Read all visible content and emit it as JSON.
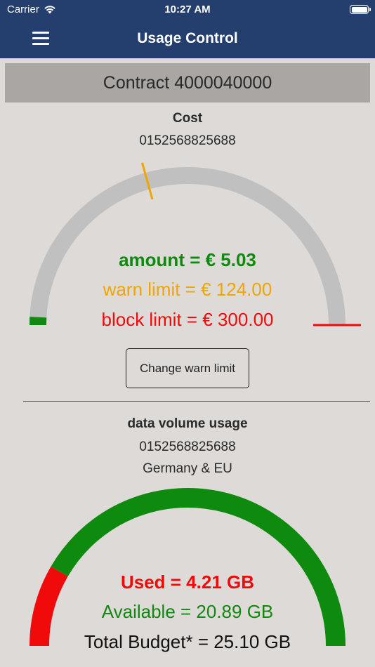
{
  "status": {
    "carrier": "Carrier",
    "time": "10:27 AM"
  },
  "nav": {
    "title": "Usage Control",
    "menu_icon": "hamburger-icon"
  },
  "contract": {
    "label": "Contract 4000040000"
  },
  "cost": {
    "title": "Cost",
    "number": "0152568825688",
    "amount_text": "amount = € 5.03",
    "warn_text": "warn limit = € 124.00",
    "block_text": "block limit = € 300.00",
    "amount": 5.03,
    "warn_limit": 124.0,
    "block_limit": 300.0,
    "change_button_label": "Change warn limit",
    "colors": {
      "track": "#c0c0c0",
      "amount": "#0e8a0e",
      "warn": "#f0a500",
      "block": "#f00a0a"
    }
  },
  "data_volume": {
    "title": "data volume usage",
    "number": "0152568825688",
    "region": "Germany & EU",
    "used_text": "Used = 4.21 GB",
    "available_text": "Available = 20.89 GB",
    "total_text": "Total Budget* = 25.10 GB",
    "used_gb": 4.21,
    "available_gb": 20.89,
    "total_gb": 25.1,
    "colors": {
      "used": "#f00a0a",
      "available": "#0e8a0e"
    }
  }
}
